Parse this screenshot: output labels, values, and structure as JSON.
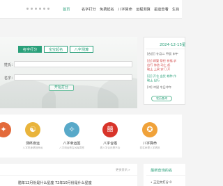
{
  "nav": {
    "items": [
      "首页",
      "名字打分",
      "免费起名",
      "八字算命",
      "运程测算",
      "星座查看",
      "生肖"
    ],
    "active_index": 0,
    "accent": "#2aa07a"
  },
  "hero": {
    "tabs": [
      "名字打分",
      "宝宝起名",
      "八字测算"
    ],
    "active_tab": 0,
    "surname_label": "姓氏：",
    "name_label": "名字：",
    "submit_label": "开始打分"
  },
  "calendar": {
    "date": "2024-12-15星",
    "lines": [
      {
        "text": "[农历] 冬月二 甲辰 申午",
        "color": "#666666"
      },
      {
        "text": "[宜] 嫁娶 祭祀 祈福 求",
        "color": "#d24a4a"
      },
      {
        "text": "    出行 修造 动土 起",
        "color": "#d24a4a"
      },
      {
        "text": "    破土 上梁 安门 开",
        "color": "#d24a4a"
      },
      {
        "text": "[忌] 开仓 出货 栽种 作",
        "color": "#2aa07a"
      },
      {
        "text": "    破土 出行",
        "color": "#2aa07a"
      },
      {
        "text": "[冲] 冲鼠 冬日冲午",
        "color": "#666666"
      }
    ],
    "more_label": "农历查询",
    "red": "#d24a4a",
    "green": "#2aa07a"
  },
  "features": [
    {
      "name": "",
      "desc": "",
      "icon": "scroll-icon",
      "color": "#e36a3b",
      "glyph": "✦"
    },
    {
      "name": "测终身运",
      "desc": "八字终身精批命运",
      "icon": "yin-yang-icon",
      "color": "#e9b43c",
      "glyph": "☯"
    },
    {
      "name": "八字幸运签",
      "desc": "八字测运势吉凶每周签",
      "icon": "compass-icon",
      "color": "#58a9c9",
      "glyph": "✧"
    },
    {
      "name": "八字合婚",
      "desc": "看八字合还是不合",
      "icon": "marriage-icon",
      "color": "#d8342a",
      "glyph": "囍"
    },
    {
      "name": "八字算命",
      "desc": "四柱命理八字精批",
      "icon": "ox-icon",
      "color": "#f0a23a",
      "glyph": "✪"
    }
  ],
  "news": {
    "more_label": "更多资讯 »",
    "item": "腊年12月份是什么星座 72年10月份是什么星座"
  },
  "side": {
    "title": "最新查询的名",
    "item": "• 王迈文打分 0"
  }
}
